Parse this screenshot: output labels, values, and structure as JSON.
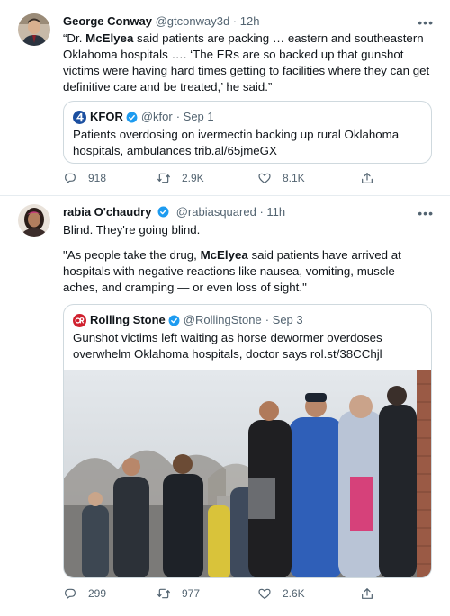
{
  "colors": {
    "verified": "#1d9bf0",
    "text_secondary": "#536471",
    "border": "#cfd9de"
  },
  "tweets": [
    {
      "name": "George Conway",
      "handle": "@gtconway3d",
      "time": "· 12h",
      "text_parts": [
        "“Dr. ",
        "McElyea",
        " said patients are packing … eastern and southeastern Oklahoma hospitals …. ‘The ERs are so backed up that gunshot victims were having hard times getting to facilities where they can get definitive care and be treated,’ he said.”"
      ],
      "quote": {
        "name": "KFOR",
        "handle": "@kfor",
        "time": "· Sep 1",
        "text": "Patients overdosing on ivermectin backing up rural Oklahoma hospitals, ambulances trib.al/65jmeGX"
      },
      "replies": "918",
      "retweets": "2.9K",
      "likes": "8.1K"
    },
    {
      "name": "rabia O'chaudry",
      "handle": "@rabiasquared",
      "time": "· 11h",
      "line1": "Blind. They're going blind.",
      "text_parts": [
        "\"As people take the drug, ",
        "McElyea",
        " said patients have arrived at hospitals with negative reactions like nausea, vomiting, muscle aches, and cramping — or even loss of sight.\""
      ],
      "quote": {
        "name": "Rolling Stone",
        "handle": "@RollingStone",
        "time": "· Sep 3",
        "text": "Gunshot victims left waiting as horse dewormer overdoses overwhelm Oklahoma hospitals, doctor says rol.st/38CChjl"
      },
      "replies": "299",
      "retweets": "977",
      "likes": "2.6K"
    }
  ],
  "icons": [
    "reply-icon",
    "retweet-icon",
    "like-icon",
    "share-icon",
    "more-icon",
    "verified-icon"
  ]
}
